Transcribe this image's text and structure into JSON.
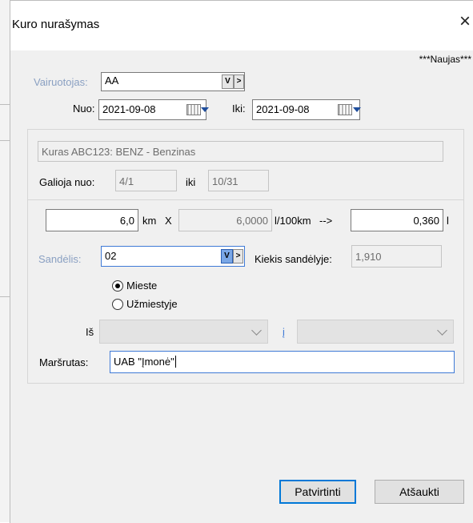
{
  "dialog": {
    "title": "Kuro nurašymas",
    "close_glyph": "×",
    "status_text": "***Naujas***"
  },
  "driver": {
    "label": "Vairuotojas:",
    "value": "AA",
    "picker_label": "V",
    "next_label": ">"
  },
  "dates": {
    "from_label": "Nuo:",
    "from_value": "2021-09-08",
    "to_label": "Iki:",
    "to_value": "2021-09-08"
  },
  "fuel": {
    "description": "Kuras ABC123: BENZ - Benzinas",
    "valid_from_label": "Galioja nuo:",
    "valid_from_value": "4/1",
    "valid_to_label": "iki",
    "valid_to_value": "10/31"
  },
  "calc": {
    "distance_value": "6,0",
    "distance_unit": "km",
    "times": "X",
    "rate_value": "6,0000",
    "rate_unit": "l/100km",
    "arrow": "-->",
    "result_value": "0,360",
    "result_unit": "l"
  },
  "warehouse": {
    "label": "Sandėlis:",
    "value": "02",
    "picker_label": "V",
    "next_label": ">",
    "stock_label": "Kiekis sandėlyje:",
    "stock_value": "1,910"
  },
  "area": {
    "options": [
      {
        "label": "Mieste",
        "selected": true
      },
      {
        "label": "Užmiestyje",
        "selected": false
      }
    ]
  },
  "route_points": {
    "from_label": "Iš",
    "to_label": "į"
  },
  "route": {
    "label": "Maršrutas:",
    "value": "UAB \"Įmonė\""
  },
  "buttons": {
    "confirm": "Patvirtinti",
    "cancel": "Atšaukti"
  }
}
